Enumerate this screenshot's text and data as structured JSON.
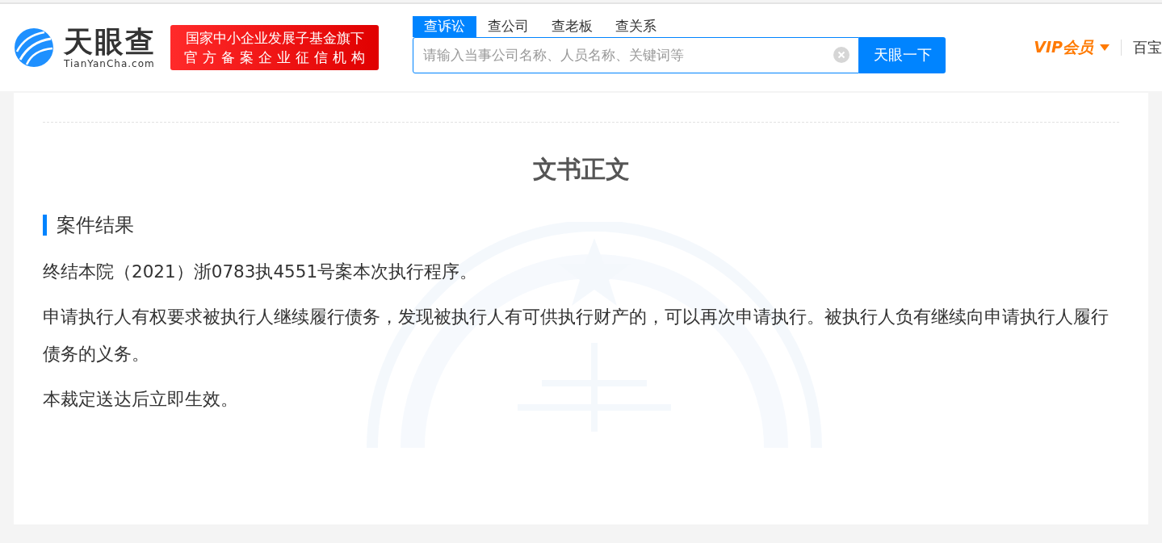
{
  "header": {
    "logo_text": "天眼查",
    "logo_domain": "TianYanCha.com",
    "badge_lines": [
      "国家中小企业发展子基金旗下",
      "官方备案企业征信机构"
    ],
    "search_tabs": [
      {
        "label": "查诉讼",
        "selected": true
      },
      {
        "label": "查公司",
        "selected": false
      },
      {
        "label": "查老板",
        "selected": false
      },
      {
        "label": "查关系",
        "selected": false
      }
    ],
    "search": {
      "placeholder": "请输入当事公司名称、人员名称、关键词等",
      "button": "天眼一下"
    },
    "vip": "VIP会员",
    "more": "百宝"
  },
  "document": {
    "title": "文书正文",
    "section": "案件结果",
    "paragraphs": [
      "终结本院（2021）浙0783执4551号案本次执行程序。",
      "申请执行人有权要求被执行人继续履行债务，发现被执行人有可供执行财产的，可以再次申请执行。被执行人负有继续向申请执行人履行债务的义务。",
      "本裁定送达后立即生效。"
    ]
  }
}
